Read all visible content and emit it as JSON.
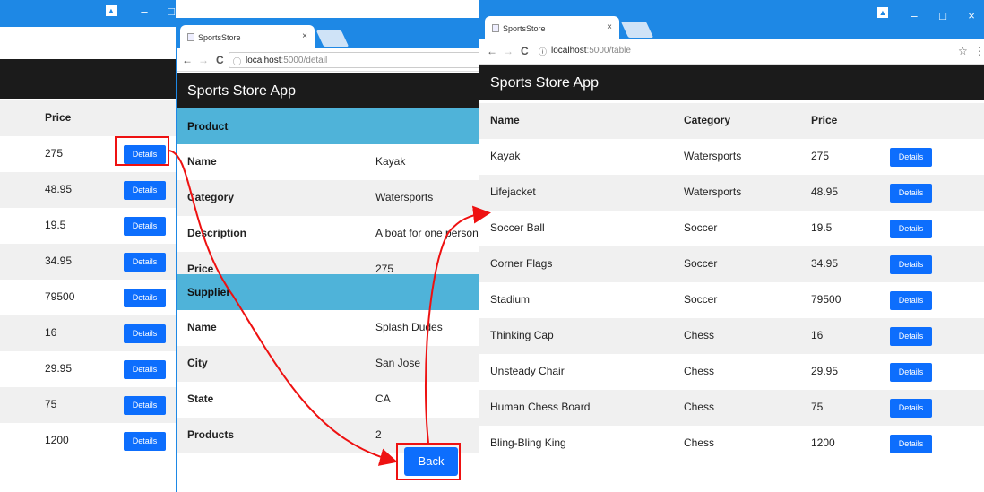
{
  "app": {
    "brand": "Sports Store App"
  },
  "left_window": {
    "header": "Price",
    "prices": [
      "275",
      "48.95",
      "19.5",
      "34.95",
      "79500",
      "16",
      "29.95",
      "75",
      "1200"
    ],
    "button_label": "Details"
  },
  "detail_window": {
    "tab_title": "SportsStore",
    "tab_close": "×",
    "url_host": "localhost",
    "url_rest": ":5000/detail",
    "product_section": "Product",
    "product_rows": [
      {
        "label": "Name",
        "value": "Kayak"
      },
      {
        "label": "Category",
        "value": "Watersports"
      },
      {
        "label": "Description",
        "value": "A boat for one person"
      },
      {
        "label": "Price",
        "value": "275"
      }
    ],
    "supplier_section": "Supplier",
    "supplier_rows": [
      {
        "label": "Name",
        "value": "Splash Dudes"
      },
      {
        "label": "City",
        "value": "San Jose"
      },
      {
        "label": "State",
        "value": "CA"
      },
      {
        "label": "Products",
        "value": "2"
      }
    ],
    "back_label": "Back"
  },
  "table_window": {
    "tab_title": "SportsStore",
    "tab_close": "×",
    "url_host": "localhost",
    "url_rest": ":5000/table",
    "columns": [
      "Name",
      "Category",
      "Price"
    ],
    "rows": [
      {
        "name": "Kayak",
        "category": "Watersports",
        "price": "275"
      },
      {
        "name": "Lifejacket",
        "category": "Watersports",
        "price": "48.95"
      },
      {
        "name": "Soccer Ball",
        "category": "Soccer",
        "price": "19.5"
      },
      {
        "name": "Corner Flags",
        "category": "Soccer",
        "price": "34.95"
      },
      {
        "name": "Stadium",
        "category": "Soccer",
        "price": "79500"
      },
      {
        "name": "Thinking Cap",
        "category": "Chess",
        "price": "16"
      },
      {
        "name": "Unsteady Chair",
        "category": "Chess",
        "price": "29.95"
      },
      {
        "name": "Human Chess Board",
        "category": "Chess",
        "price": "75"
      },
      {
        "name": "Bling-Bling King",
        "category": "Chess",
        "price": "1200"
      }
    ],
    "button_label": "Details"
  },
  "window_controls": {
    "minimize": "–",
    "maximize": "□",
    "close": "×",
    "user": "▲"
  },
  "browser_icons": {
    "back": "←",
    "forward": "→",
    "reload": "C",
    "info": "ⓘ",
    "star": "☆",
    "menu": "⋮"
  },
  "colors": {
    "titlebar": "#1e88e5",
    "appbar": "#1b1b1b",
    "section": "#4fb3d9",
    "button": "#0d6efd",
    "highlight": "#e11111"
  }
}
